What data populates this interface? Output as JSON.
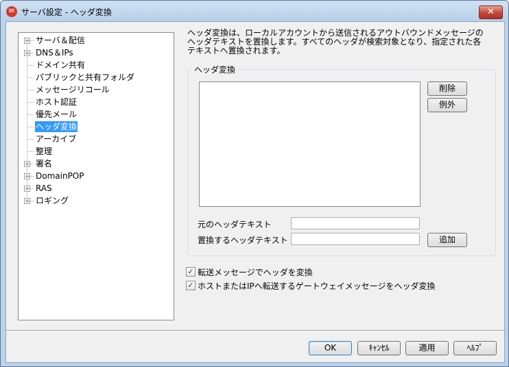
{
  "window": {
    "title": "サーバ設定 - ヘッダ変換",
    "close_label": "✕"
  },
  "tree": {
    "items": [
      {
        "label": "サーバ＆配信",
        "expander": "+"
      },
      {
        "label": "DNS＆IPs",
        "expander": "+"
      },
      {
        "label": "ドメイン共有",
        "expander": ""
      },
      {
        "label": "パブリックと共有フォルダ",
        "expander": ""
      },
      {
        "label": "メッセージリコール",
        "expander": ""
      },
      {
        "label": "ホスト認証",
        "expander": ""
      },
      {
        "label": "優先メール",
        "expander": ""
      },
      {
        "label": "ヘッダ変換",
        "expander": "",
        "selected": true
      },
      {
        "label": "アーカイブ",
        "expander": ""
      },
      {
        "label": "整理",
        "expander": ""
      },
      {
        "label": "署名",
        "expander": "+"
      },
      {
        "label": "DomainPOP",
        "expander": "+"
      },
      {
        "label": "RAS",
        "expander": "+"
      },
      {
        "label": "ロギング",
        "expander": "+"
      }
    ]
  },
  "description": {
    "line1": "ヘッダ変換は、ローカルアカウントから送信されるアウトバウンドメッセージの",
    "line2": "ヘッダテキストを置換します。すべてのヘッダが検索対象となり、指定された各",
    "line3": "テキストへ置換されます。"
  },
  "group": {
    "title": "ヘッダ変換"
  },
  "buttons": {
    "delete": "削除",
    "exceptions": "例外",
    "add": "追加"
  },
  "fields": {
    "original_label": "元のヘッダテキスト",
    "original_value": "",
    "replace_label": "置換するヘッダテキスト",
    "replace_value": ""
  },
  "checkboxes": {
    "forward": {
      "label": "転送メッセージでヘッダを変換",
      "checked": true
    },
    "gateway": {
      "label": "ホストまたはIPへ転送するゲートウェイメッセージをヘッダ変換",
      "checked": true
    }
  },
  "footer": {
    "ok": "OK",
    "cancel": "ｷｬﾝｾﾙ",
    "apply": "適用",
    "help": "ﾍﾙﾌﾟ"
  },
  "check_mark": "✓"
}
